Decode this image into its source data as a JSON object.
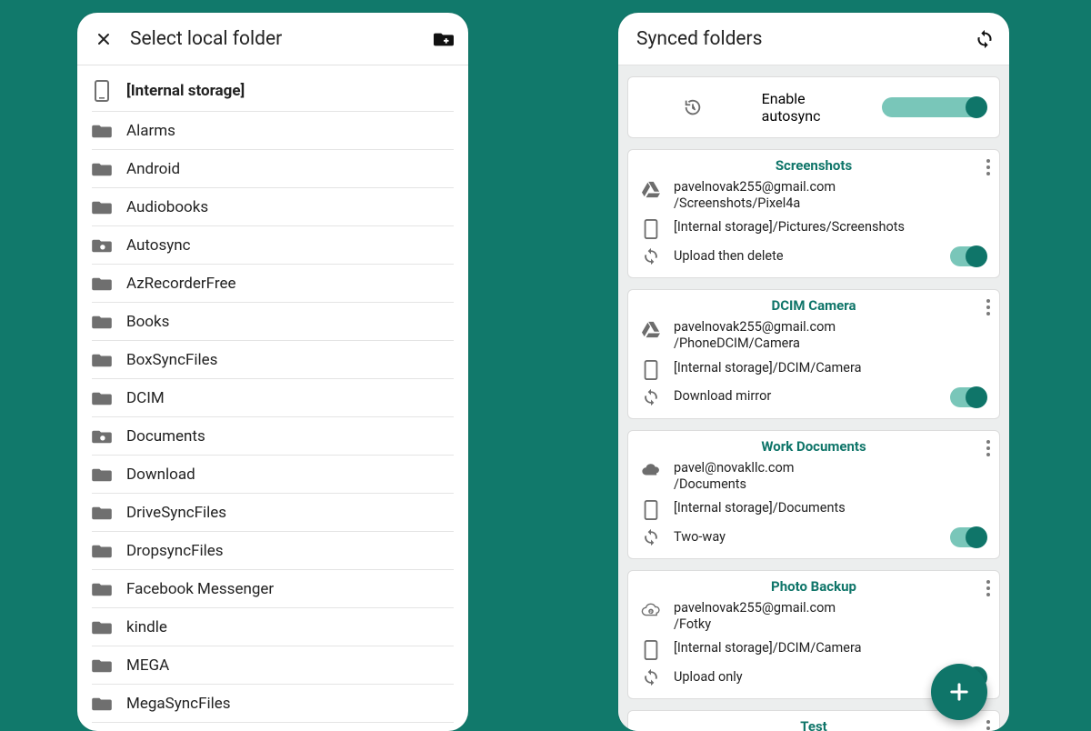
{
  "left": {
    "title": "Select local folder",
    "storage_header": "[Internal storage]",
    "folders": [
      {
        "name": "Alarms",
        "icon": "folder"
      },
      {
        "name": "Android",
        "icon": "folder"
      },
      {
        "name": "Audiobooks",
        "icon": "folder"
      },
      {
        "name": "Autosync",
        "icon": "camera-folder"
      },
      {
        "name": "AzRecorderFree",
        "icon": "folder"
      },
      {
        "name": "Books",
        "icon": "folder"
      },
      {
        "name": "BoxSyncFiles",
        "icon": "folder"
      },
      {
        "name": "DCIM",
        "icon": "folder"
      },
      {
        "name": "Documents",
        "icon": "camera-folder"
      },
      {
        "name": "Download",
        "icon": "folder"
      },
      {
        "name": "DriveSyncFiles",
        "icon": "folder"
      },
      {
        "name": "DropsyncFiles",
        "icon": "folder"
      },
      {
        "name": "Facebook Messenger",
        "icon": "folder"
      },
      {
        "name": "kindle",
        "icon": "folder"
      },
      {
        "name": "MEGA",
        "icon": "folder"
      },
      {
        "name": "MegaSyncFiles",
        "icon": "folder"
      }
    ]
  },
  "right": {
    "title": "Synced folders",
    "autosync_label": "Enable autosync",
    "cards": [
      {
        "title": "Screenshots",
        "remote_icon": "drive",
        "remote": "pavelnovak255@gmail.com\n/Screenshots/Pixel4a",
        "local": "[Internal storage]/Pictures/Screenshots",
        "mode": "Upload then delete",
        "enabled": true
      },
      {
        "title": "DCIM Camera",
        "remote_icon": "drive",
        "remote": "pavelnovak255@gmail.com\n/PhoneDCIM/Camera",
        "local": "[Internal storage]/DCIM/Camera",
        "mode": "Download mirror",
        "enabled": true
      },
      {
        "title": "Work Documents",
        "remote_icon": "onedrive",
        "remote": "pavel@novakllc.com\n/Documents",
        "local": "[Internal storage]/Documents",
        "mode": "Two-way",
        "enabled": true
      },
      {
        "title": "Photo Backup",
        "remote_icon": "pcloud",
        "remote": "pavelnovak255@gmail.com\n/Fotky",
        "local": "[Internal storage]/DCIM/Camera",
        "mode": "Upload only",
        "enabled": true
      },
      {
        "title": "Test",
        "remote_icon": "drive",
        "remote": "",
        "local": "",
        "mode": "",
        "enabled": true
      }
    ]
  }
}
